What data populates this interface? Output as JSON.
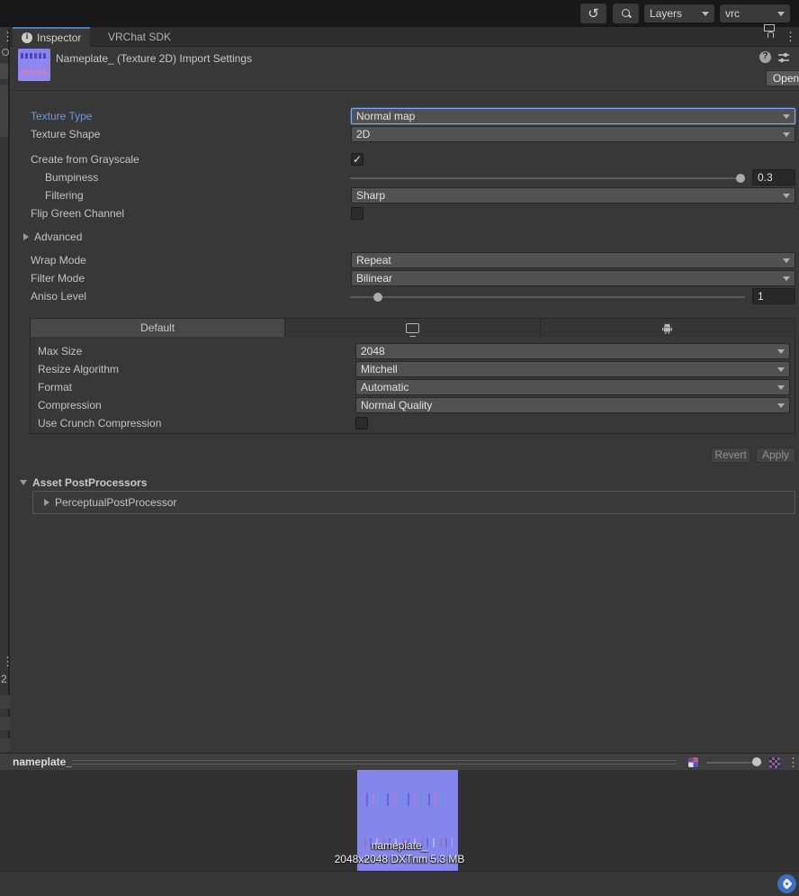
{
  "toolbar": {
    "layers_label": "Layers",
    "layer_selection": "vrc"
  },
  "tab_bar": {
    "inspector_tab": "Inspector",
    "vrchat_sdk_tab": "VRChat SDK"
  },
  "header": {
    "title": "Nameplate_ (Texture 2D) Import Settings",
    "open_button": "Open"
  },
  "settings": {
    "texture_type": {
      "label": "Texture Type",
      "value": "Normal map"
    },
    "texture_shape": {
      "label": "Texture Shape",
      "value": "2D"
    },
    "create_from_grayscale": {
      "label": "Create from Grayscale",
      "checked": true
    },
    "bumpiness": {
      "label": "Bumpiness",
      "value": "0.3"
    },
    "filtering": {
      "label": "Filtering",
      "value": "Sharp"
    },
    "flip_green_channel": {
      "label": "Flip Green Channel",
      "checked": false
    },
    "advanced": {
      "label": "Advanced"
    },
    "wrap_mode": {
      "label": "Wrap Mode",
      "value": "Repeat"
    },
    "filter_mode": {
      "label": "Filter Mode",
      "value": "Bilinear"
    },
    "aniso_level": {
      "label": "Aniso Level",
      "value": "1"
    }
  },
  "platform_panel": {
    "default_tab": "Default",
    "max_size": {
      "label": "Max Size",
      "value": "2048"
    },
    "resize_algorithm": {
      "label": "Resize Algorithm",
      "value": "Mitchell"
    },
    "format": {
      "label": "Format",
      "value": "Automatic"
    },
    "compression": {
      "label": "Compression",
      "value": "Normal Quality"
    },
    "use_crunch_compression": {
      "label": "Use Crunch Compression",
      "checked": false
    }
  },
  "actions": {
    "revert_button": "Revert",
    "apply_button": "Apply"
  },
  "post_processors": {
    "header": "Asset PostProcessors",
    "item": "PerceptualPostProcessor"
  },
  "preview": {
    "title": "nameplate_",
    "overlay_name": "nameplate_",
    "overlay_info": "2048x2048  DXTnm  5.3 MB"
  },
  "left_panel": {
    "row_number": "2"
  },
  "colors": {
    "accent_label": "#7096d8",
    "tab_highlight": "#497bbf",
    "normal_map_purple": "#8586ec",
    "asset_tag_blue": "#3d6ebf"
  }
}
